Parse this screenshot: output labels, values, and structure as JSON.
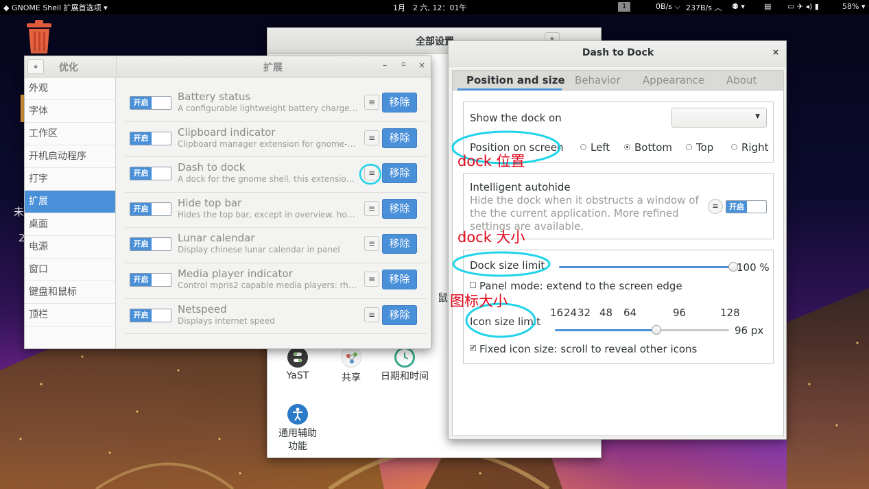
{
  "topbar": {
    "app_menu": "GNOME Shell 扩展首选项",
    "clock": "1月　2 六, 12：01午",
    "workspace": "1",
    "net_down": "0B/s",
    "net_up": "237B/s",
    "battery": "58%"
  },
  "desktop": {
    "frag1": "未",
    "frag2": "2",
    "frag3": "鼠"
  },
  "settings_window": {
    "title": "全部设置",
    "icons": [
      {
        "label": "YaST",
        "icon": "yast-icon"
      },
      {
        "label": "共享",
        "icon": "share-icon"
      },
      {
        "label": "日期和时间",
        "icon": "clock-icon"
      },
      {
        "label": "通用辅助功能",
        "icon": "accessibility-icon"
      }
    ]
  },
  "tweak": {
    "app_title": "优化",
    "section_title": "扩展",
    "sidebar": [
      "外观",
      "字体",
      "工作区",
      "开机启动程序",
      "打字",
      "扩展",
      "桌面",
      "电源",
      "窗口",
      "键盘和鼠标",
      "顶栏"
    ],
    "active_index": 5,
    "toggle_on_label": "开启",
    "remove_label": "移除",
    "extensions": [
      {
        "name": "Battery status",
        "desc": "A configurable lightweight battery charge in..."
      },
      {
        "name": "Clipboard indicator",
        "desc": "Clipboard manager extension for gnome-sh..."
      },
      {
        "name": "Dash to dock",
        "desc": "A dock for the gnome shell. this extension m..."
      },
      {
        "name": "Hide top bar",
        "desc": "Hides the top bar, except in overview. howev..."
      },
      {
        "name": "Lunar calendar",
        "desc": "Display chinese lunar calendar in panel"
      },
      {
        "name": "Media player indicator",
        "desc": "Control mpris2 capable media players: rhyth..."
      },
      {
        "name": "Netspeed",
        "desc": "Displays internet speed"
      }
    ]
  },
  "dock": {
    "title": "Dash to Dock",
    "tabs": [
      "Position and size",
      "Behavior",
      "Appearance",
      "About"
    ],
    "show_dock_on": "Show the dock on",
    "position_on_screen": "Position on screen",
    "positions": [
      "Left",
      "Bottom",
      "Top",
      "Right"
    ],
    "selected_position": "Bottom",
    "autohide_title": "Intelligent autohide",
    "autohide_desc_1": "Hide the dock when it obstructs a window of",
    "autohide_desc_2": "the the current application. More refined",
    "autohide_desc_3": "settings are available.",
    "autohide_toggle": "开启",
    "dock_size_limit": "Dock size limit",
    "dock_size_value": 100,
    "dock_size_display": "100 %",
    "panel_mode": "Panel mode: extend to the screen edge",
    "icon_size_limit": "Icon size limit",
    "icon_ticks": [
      "16",
      "24",
      "32",
      "48",
      "64",
      "96",
      "128"
    ],
    "icon_size_value": 96,
    "icon_size_display": "96 px",
    "fixed_icon": "Fixed icon size: scroll to reveal other icons"
  },
  "annotations": {
    "position": "dock 位置",
    "size": "dock 大小",
    "icon": "图标大小",
    "color": "#e3061c",
    "highlight_color": "#1fd3e8"
  }
}
